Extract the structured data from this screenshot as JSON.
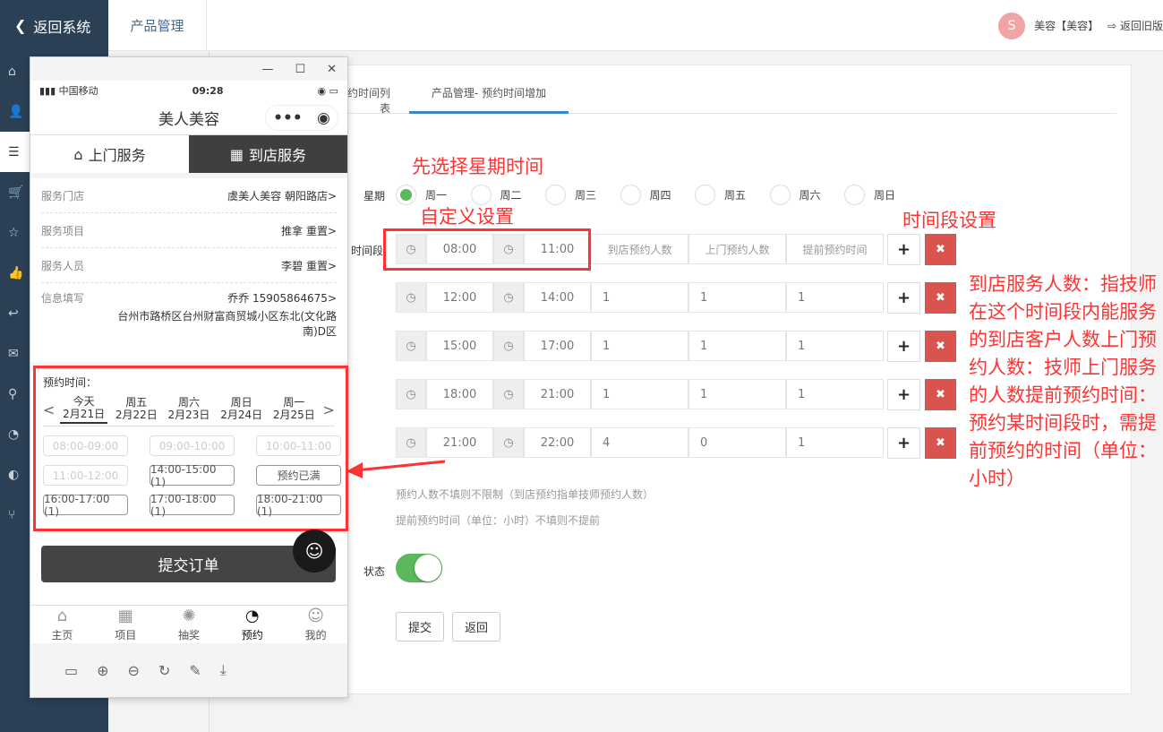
{
  "sidebar": {
    "back_label": "返回系统",
    "items": [
      {
        "icon": "home-icon",
        "label": "首页"
      },
      {
        "icon": "user-icon",
        "label": "用户"
      },
      {
        "icon": "server-icon",
        "label": "产品"
      },
      {
        "icon": "cart-icon",
        "label": "订单"
      },
      {
        "icon": "star-icon",
        "label": "评价"
      },
      {
        "icon": "thumbs-up-icon",
        "label": "营销"
      },
      {
        "icon": "reply-icon",
        "label": "消息"
      },
      {
        "icon": "wechat-icon",
        "label": "微信"
      },
      {
        "icon": "map-marker-icon",
        "label": "门店"
      },
      {
        "icon": "pie-chart-icon",
        "label": "统计"
      },
      {
        "icon": "adjust-icon",
        "label": "设置"
      },
      {
        "icon": "code-fork-icon",
        "label": "接口"
      }
    ]
  },
  "header": {
    "tab": "产品管理",
    "user": "美容【美容】",
    "old_version": "返回旧版"
  },
  "main": {
    "tabs": [
      "预约时间列表",
      "产品管理- 预约时间增加"
    ],
    "week_label": "星期",
    "weekdays": [
      "周一",
      "周二",
      "周三",
      "周四",
      "周五",
      "周六",
      "周日"
    ],
    "selected_weekday": "周一",
    "period_label": "时间段",
    "placeholders": {
      "store": "到店预约人数",
      "home": "上门预约人数",
      "advance": "提前预约时间"
    },
    "rows": [
      {
        "start": "08:00",
        "end": "11:00",
        "store": "",
        "home": "",
        "advance": ""
      },
      {
        "start": "12:00",
        "end": "14:00",
        "store": "1",
        "home": "1",
        "advance": "1"
      },
      {
        "start": "15:00",
        "end": "17:00",
        "store": "1",
        "home": "1",
        "advance": "1"
      },
      {
        "start": "18:00",
        "end": "21:00",
        "store": "1",
        "home": "1",
        "advance": "1"
      },
      {
        "start": "21:00",
        "end": "22:00",
        "store": "4",
        "home": "0",
        "advance": "1"
      }
    ],
    "hint1": "预约人数不填则不限制（到店预约指单技师预约人数）",
    "hint2": "提前预约时间（单位：小时）不填则不提前",
    "status_label": "状态",
    "status_on": true,
    "submit": "提交",
    "back": "返回"
  },
  "annotations": {
    "a1": "先选择星期时间",
    "a2": "自定义设置",
    "a3": "时间段设置",
    "a4": "到店服务人数：指技师在这个时间段内能服务的到店客户人数上门预约人数：技师上门服务的人数提前预约时间：预约某时间段时，需提前预约的时间（单位：小时）"
  },
  "phone": {
    "carrier": "中国移动",
    "time": "09:28",
    "title": "美人美容",
    "tabs": [
      "上门服务",
      "到店服务"
    ],
    "info": [
      {
        "k": "服务门店",
        "v": "虞美人美容 朝阳路店>"
      },
      {
        "k": "服务项目",
        "v": "推拿 重置>"
      },
      {
        "k": "服务人员",
        "v": "李碧 重置>"
      },
      {
        "k": "信息填写",
        "v": "乔乔 15905864675>",
        "v2": "台州市路桥区台州财富商贸城小区东北(文化路南)D区"
      }
    ],
    "book_label": "预约时间：",
    "days": [
      {
        "w": "今天",
        "d": "2月21日"
      },
      {
        "w": "周五",
        "d": "2月22日"
      },
      {
        "w": "周六",
        "d": "2月23日"
      },
      {
        "w": "周日",
        "d": "2月24日"
      },
      {
        "w": "周一",
        "d": "2月25日"
      }
    ],
    "slots": [
      "08:00-09:00",
      "09:00-10:00",
      "10:00-11:00",
      "11:00-12:00",
      "14:00-15:00 (1)",
      "预约已满",
      "16:00-17:00 (1)",
      "17:00-18:00 (1)",
      "18:00-21:00 (1)"
    ],
    "submit": "提交订单",
    "tabbar": [
      "主页",
      "项目",
      "抽奖",
      "预约",
      "我的"
    ]
  }
}
